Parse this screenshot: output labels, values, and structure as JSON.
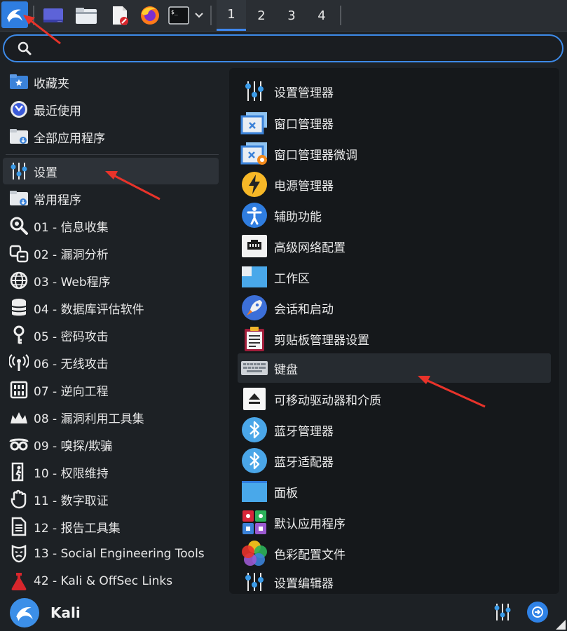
{
  "workspaces": [
    "1",
    "2",
    "3",
    "4"
  ],
  "search": {
    "placeholder": "",
    "value": ""
  },
  "categories": [
    {
      "label": "收藏夹",
      "icon": "favorites-icon"
    },
    {
      "label": "最近使用",
      "icon": "recent-icon"
    },
    {
      "label": "全部应用程序",
      "icon": "all-apps-icon"
    },
    {
      "label": "设置",
      "icon": "settings-icon",
      "selected": true
    },
    {
      "label": "常用程序",
      "icon": "usual-apps-icon"
    },
    {
      "label": "01 - 信息收集",
      "icon": "information-gathering-icon"
    },
    {
      "label": "02 - 漏洞分析",
      "icon": "vulnerability-analysis-icon"
    },
    {
      "label": "03 - Web程序",
      "icon": "web-apps-icon"
    },
    {
      "label": "04 - 数据库评估软件",
      "icon": "database-icon"
    },
    {
      "label": "05 - 密码攻击",
      "icon": "password-icon"
    },
    {
      "label": "06 - 无线攻击",
      "icon": "wireless-icon"
    },
    {
      "label": "07 - 逆向工程",
      "icon": "reverse-engineering-icon"
    },
    {
      "label": "08 - 漏洞利用工具集",
      "icon": "exploitation-icon"
    },
    {
      "label": "09 - 嗅探/欺骗",
      "icon": "sniffing-icon"
    },
    {
      "label": "10 - 权限维持",
      "icon": "post-exploitation-icon"
    },
    {
      "label": "11 - 数字取证",
      "icon": "forensics-icon"
    },
    {
      "label": "12 - 报告工具集",
      "icon": "reporting-icon"
    },
    {
      "label": "13 - Social Engineering Tools",
      "icon": "social-engineering-icon"
    },
    {
      "label": "42 - Kali & OffSec Links",
      "icon": "kali-links-icon"
    }
  ],
  "apps": [
    {
      "label": "设置管理器",
      "icon": "settings-manager-icon"
    },
    {
      "label": "窗口管理器",
      "icon": "window-manager-icon"
    },
    {
      "label": "窗口管理器微调",
      "icon": "window-manager-tweaks-icon"
    },
    {
      "label": "电源管理器",
      "icon": "power-manager-icon"
    },
    {
      "label": "辅助功能",
      "icon": "accessibility-icon"
    },
    {
      "label": "高级网络配置",
      "icon": "network-icon"
    },
    {
      "label": "工作区",
      "icon": "workspaces-icon"
    },
    {
      "label": "会话和启动",
      "icon": "session-startup-icon"
    },
    {
      "label": "剪贴板管理器设置",
      "icon": "clipboard-icon"
    },
    {
      "label": "键盘",
      "icon": "keyboard-icon",
      "selected": true
    },
    {
      "label": "可移动驱动器和介质",
      "icon": "removable-drives-icon"
    },
    {
      "label": "蓝牙管理器",
      "icon": "bluetooth-manager-icon"
    },
    {
      "label": "蓝牙适配器",
      "icon": "bluetooth-adapter-icon"
    },
    {
      "label": "面板",
      "icon": "panel-icon"
    },
    {
      "label": "默认应用程序",
      "icon": "default-apps-icon"
    },
    {
      "label": "色彩配置文件",
      "icon": "color-profiles-icon"
    },
    {
      "label": "设置编辑器",
      "icon": "settings-editor-icon"
    }
  ],
  "user": {
    "name": "Kali"
  },
  "colors": {
    "accent": "#3d8ae8",
    "arrow": "#e8332a"
  }
}
